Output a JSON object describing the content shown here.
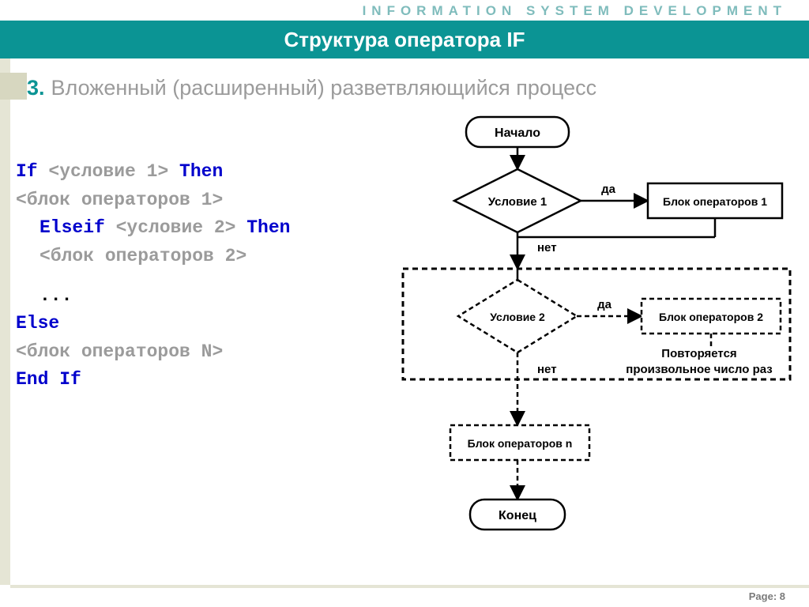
{
  "header": {
    "topline": "INFORMATION  SYSTEM   DEVELOPMENT",
    "title": "Структура оператора IF"
  },
  "subtitle": {
    "number": "3.",
    "text": "Вложенный (расширенный) разветвляющийся процесс"
  },
  "code": {
    "l1_kw1": "If ",
    "l1_body": "<условие 1>",
    "l1_kw2": " Then",
    "l2": "<блок операторов 1>",
    "l3_kw1": "Elseif ",
    "l3_body": "<условие 2>",
    "l3_kw2": " Then",
    "l4": "<блок операторов 2>",
    "l5": "...",
    "l6": "Else",
    "l7": "<блок операторов N>",
    "l8": "End If"
  },
  "flow": {
    "start": "Начало",
    "cond1": "Условие 1",
    "block1": "Блок операторов 1",
    "yes": "да",
    "no": "нет",
    "cond2": "Условие 2",
    "block2": "Блок операторов 2",
    "note1": "Повторяется",
    "note2": "произвольное число раз",
    "blockn": "Блок операторов n",
    "end": "Конец"
  },
  "footer": {
    "page_label": "Page: ",
    "page_number": "8"
  }
}
